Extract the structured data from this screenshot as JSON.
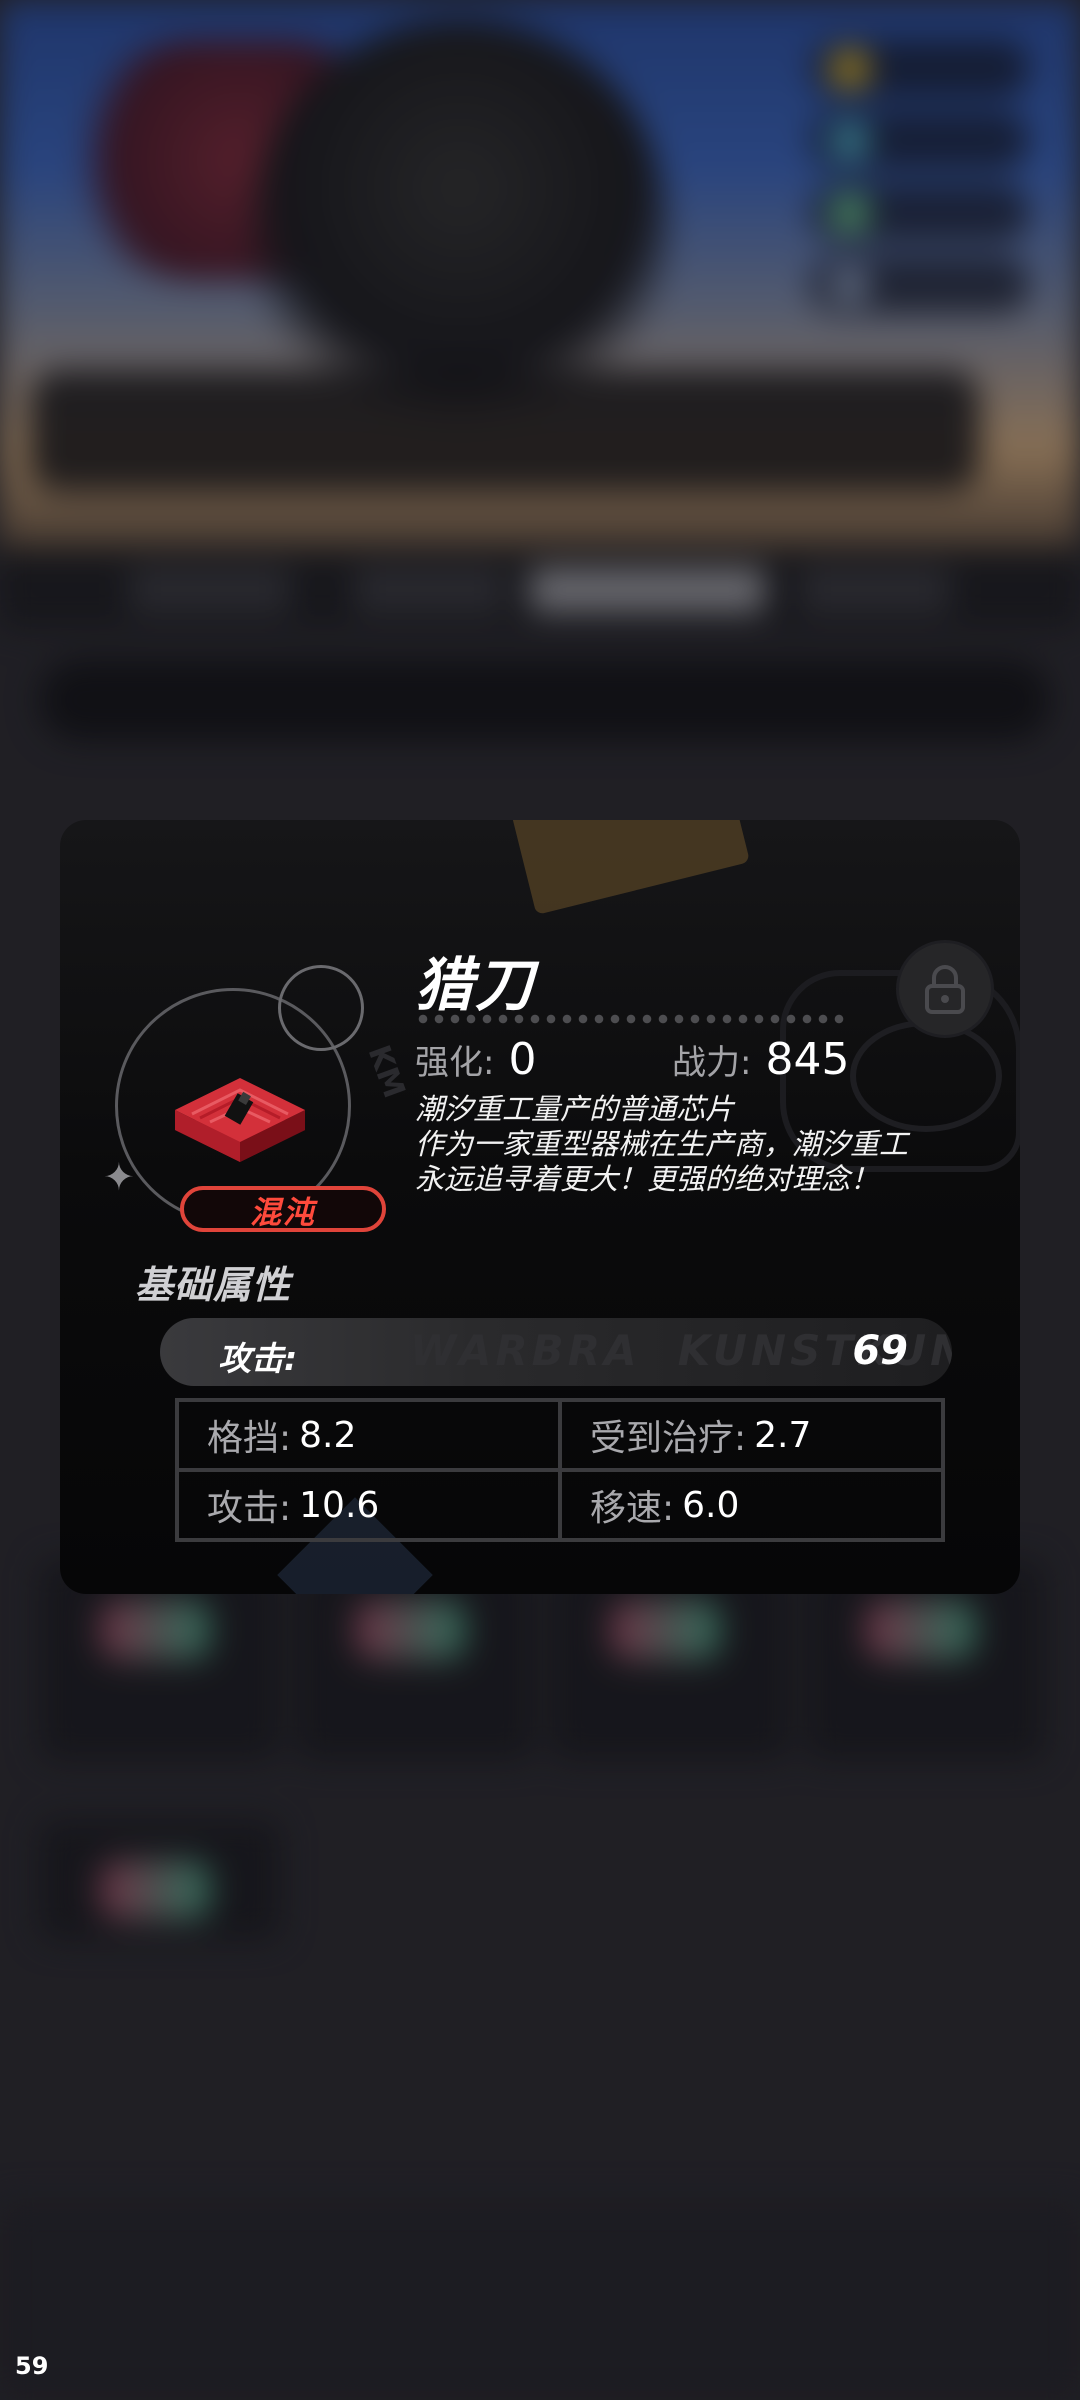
{
  "item": {
    "name": "猎刀",
    "rarity": "混沌",
    "enhance_label": "强化:",
    "enhance_value": "0",
    "power_label": "战力:",
    "power_value": "845",
    "description": [
      "潮汐重工量产的普通芯片",
      "作为一家重型器械在生产商，潮汐重工",
      "永远追寻着更大！更强的绝对理念！"
    ],
    "lock_icon": "lock-icon",
    "chip_icon": "red-chip-icon",
    "colors": {
      "rarity": "#e0443a",
      "chip": "#d3303a"
    }
  },
  "base_attributes": {
    "title": "基础属性",
    "main": {
      "label": "攻击:",
      "value": "69"
    },
    "subs": [
      {
        "label": "格挡:",
        "value": "8.2"
      },
      {
        "label": "受到治疗:",
        "value": "2.7"
      },
      {
        "label": "攻击:",
        "value": "10.6"
      },
      {
        "label": "移速:",
        "value": "6.0"
      }
    ]
  },
  "fps": "59"
}
